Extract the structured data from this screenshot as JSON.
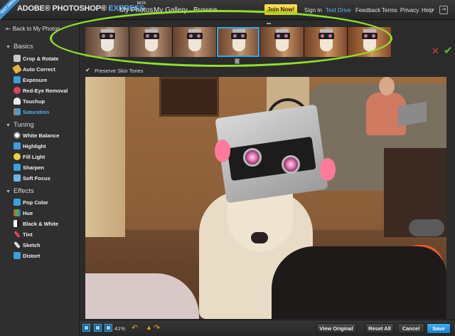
{
  "header": {
    "ribbon": "TEST DRIVE",
    "logo_main": "ADOBE® PHOTOSHOP®",
    "logo_express": "EXPRESS",
    "logo_beta": "BETA",
    "nav": [
      "My Photos",
      "My Gallery",
      "Browse"
    ],
    "join": "Join Now!",
    "links": [
      "Sign In",
      "Test Drive",
      "Feedback",
      "Terms",
      "Privacy",
      "Help"
    ],
    "active_link": "Test Drive",
    "accent": "#4fb0e8",
    "join_color": "#f5c400"
  },
  "sidebar": {
    "back": "Back to My Photos",
    "sections": [
      {
        "title": "Basics",
        "items": [
          "Crop & Rotate",
          "Auto Correct",
          "Exposure",
          "Red-Eye Removal",
          "Touchup",
          "Saturation"
        ]
      },
      {
        "title": "Tuning",
        "items": [
          "White Balance",
          "Highlight",
          "Fill Light",
          "Sharpen",
          "Soft Focus"
        ]
      },
      {
        "title": "Effects",
        "items": [
          "Pop Color",
          "Hue",
          "Black & White",
          "Tint",
          "Sketch",
          "Distort"
        ]
      }
    ],
    "active_item": "Saturation"
  },
  "filmstrip": {
    "thumbnail_count": 7,
    "selected_index": 3,
    "preserve_label": "Preserve Skin Tones",
    "preserve_checked": true,
    "slider_value": 0.5,
    "highlight_color": "#8fe02a"
  },
  "toolbar": {
    "zoom": "41%",
    "view_original": "View Original",
    "reset_all": "Reset All",
    "cancel": "Cancel",
    "save": "Save"
  }
}
